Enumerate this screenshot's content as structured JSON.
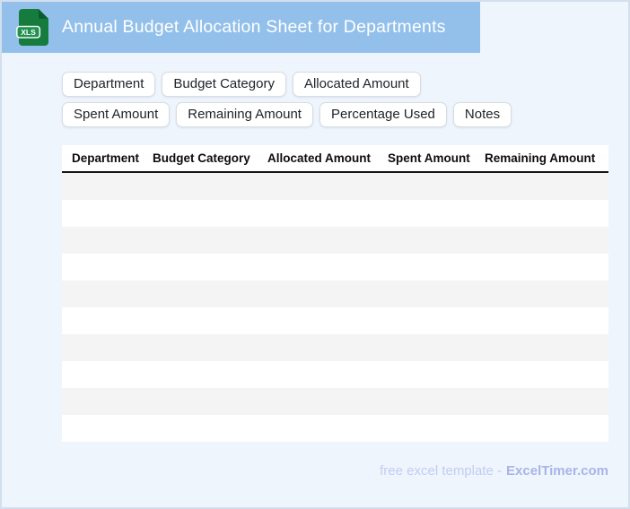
{
  "header": {
    "title": "Annual Budget Allocation Sheet for Departments",
    "icon_label": "XLS"
  },
  "tags": [
    "Department",
    "Budget Category",
    "Allocated Amount",
    "Spent Amount",
    "Remaining Amount",
    "Percentage Used",
    "Notes"
  ],
  "table": {
    "columns": [
      "Department",
      "Budget Category",
      "Allocated Amount",
      "Spent Amount",
      "Remaining Amount"
    ],
    "empty_row_count": 10,
    "column_count": 5
  },
  "footer": {
    "text": "free excel template -",
    "brand": "ExcelTimer.com"
  },
  "colors": {
    "band": "#92c0ea",
    "page-bg": "#eef5fd",
    "canvas-border": "#d3dfec",
    "tag-border": "#d9dde2",
    "tag-text": "#20242a",
    "head-text": "#0d0d0d",
    "head-rule": "#161616",
    "stripe": "#f4f4f5",
    "footer-text": "#c2ccf2",
    "footer-brand": "#a8b5e8",
    "icon-green": "#157c3e",
    "icon-fold": "#0b5c2c",
    "icon-label": "#1f9150"
  }
}
